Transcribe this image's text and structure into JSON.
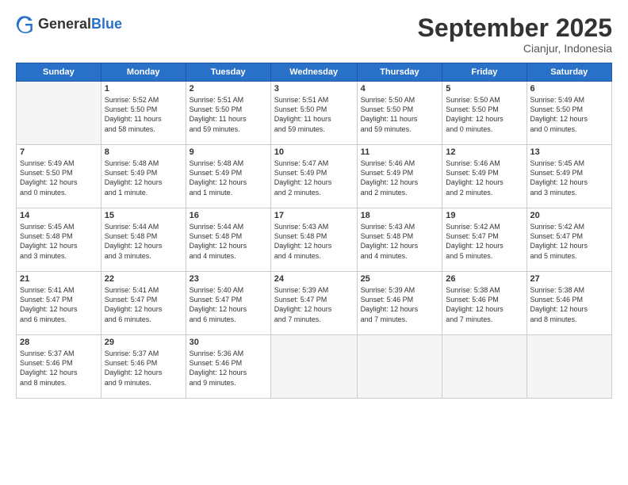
{
  "logo": {
    "general": "General",
    "blue": "Blue"
  },
  "title": "September 2025",
  "subtitle": "Cianjur, Indonesia",
  "headers": [
    "Sunday",
    "Monday",
    "Tuesday",
    "Wednesday",
    "Thursday",
    "Friday",
    "Saturday"
  ],
  "weeks": [
    [
      {
        "day": "",
        "info": ""
      },
      {
        "day": "1",
        "info": "Sunrise: 5:52 AM\nSunset: 5:50 PM\nDaylight: 11 hours\nand 58 minutes."
      },
      {
        "day": "2",
        "info": "Sunrise: 5:51 AM\nSunset: 5:50 PM\nDaylight: 11 hours\nand 59 minutes."
      },
      {
        "day": "3",
        "info": "Sunrise: 5:51 AM\nSunset: 5:50 PM\nDaylight: 11 hours\nand 59 minutes."
      },
      {
        "day": "4",
        "info": "Sunrise: 5:50 AM\nSunset: 5:50 PM\nDaylight: 11 hours\nand 59 minutes."
      },
      {
        "day": "5",
        "info": "Sunrise: 5:50 AM\nSunset: 5:50 PM\nDaylight: 12 hours\nand 0 minutes."
      },
      {
        "day": "6",
        "info": "Sunrise: 5:49 AM\nSunset: 5:50 PM\nDaylight: 12 hours\nand 0 minutes."
      }
    ],
    [
      {
        "day": "7",
        "info": "Sunrise: 5:49 AM\nSunset: 5:50 PM\nDaylight: 12 hours\nand 0 minutes."
      },
      {
        "day": "8",
        "info": "Sunrise: 5:48 AM\nSunset: 5:49 PM\nDaylight: 12 hours\nand 1 minute."
      },
      {
        "day": "9",
        "info": "Sunrise: 5:48 AM\nSunset: 5:49 PM\nDaylight: 12 hours\nand 1 minute."
      },
      {
        "day": "10",
        "info": "Sunrise: 5:47 AM\nSunset: 5:49 PM\nDaylight: 12 hours\nand 2 minutes."
      },
      {
        "day": "11",
        "info": "Sunrise: 5:46 AM\nSunset: 5:49 PM\nDaylight: 12 hours\nand 2 minutes."
      },
      {
        "day": "12",
        "info": "Sunrise: 5:46 AM\nSunset: 5:49 PM\nDaylight: 12 hours\nand 2 minutes."
      },
      {
        "day": "13",
        "info": "Sunrise: 5:45 AM\nSunset: 5:49 PM\nDaylight: 12 hours\nand 3 minutes."
      }
    ],
    [
      {
        "day": "14",
        "info": "Sunrise: 5:45 AM\nSunset: 5:48 PM\nDaylight: 12 hours\nand 3 minutes."
      },
      {
        "day": "15",
        "info": "Sunrise: 5:44 AM\nSunset: 5:48 PM\nDaylight: 12 hours\nand 3 minutes."
      },
      {
        "day": "16",
        "info": "Sunrise: 5:44 AM\nSunset: 5:48 PM\nDaylight: 12 hours\nand 4 minutes."
      },
      {
        "day": "17",
        "info": "Sunrise: 5:43 AM\nSunset: 5:48 PM\nDaylight: 12 hours\nand 4 minutes."
      },
      {
        "day": "18",
        "info": "Sunrise: 5:43 AM\nSunset: 5:48 PM\nDaylight: 12 hours\nand 4 minutes."
      },
      {
        "day": "19",
        "info": "Sunrise: 5:42 AM\nSunset: 5:47 PM\nDaylight: 12 hours\nand 5 minutes."
      },
      {
        "day": "20",
        "info": "Sunrise: 5:42 AM\nSunset: 5:47 PM\nDaylight: 12 hours\nand 5 minutes."
      }
    ],
    [
      {
        "day": "21",
        "info": "Sunrise: 5:41 AM\nSunset: 5:47 PM\nDaylight: 12 hours\nand 6 minutes."
      },
      {
        "day": "22",
        "info": "Sunrise: 5:41 AM\nSunset: 5:47 PM\nDaylight: 12 hours\nand 6 minutes."
      },
      {
        "day": "23",
        "info": "Sunrise: 5:40 AM\nSunset: 5:47 PM\nDaylight: 12 hours\nand 6 minutes."
      },
      {
        "day": "24",
        "info": "Sunrise: 5:39 AM\nSunset: 5:47 PM\nDaylight: 12 hours\nand 7 minutes."
      },
      {
        "day": "25",
        "info": "Sunrise: 5:39 AM\nSunset: 5:46 PM\nDaylight: 12 hours\nand 7 minutes."
      },
      {
        "day": "26",
        "info": "Sunrise: 5:38 AM\nSunset: 5:46 PM\nDaylight: 12 hours\nand 7 minutes."
      },
      {
        "day": "27",
        "info": "Sunrise: 5:38 AM\nSunset: 5:46 PM\nDaylight: 12 hours\nand 8 minutes."
      }
    ],
    [
      {
        "day": "28",
        "info": "Sunrise: 5:37 AM\nSunset: 5:46 PM\nDaylight: 12 hours\nand 8 minutes."
      },
      {
        "day": "29",
        "info": "Sunrise: 5:37 AM\nSunset: 5:46 PM\nDaylight: 12 hours\nand 9 minutes."
      },
      {
        "day": "30",
        "info": "Sunrise: 5:36 AM\nSunset: 5:46 PM\nDaylight: 12 hours\nand 9 minutes."
      },
      {
        "day": "",
        "info": ""
      },
      {
        "day": "",
        "info": ""
      },
      {
        "day": "",
        "info": ""
      },
      {
        "day": "",
        "info": ""
      }
    ]
  ]
}
